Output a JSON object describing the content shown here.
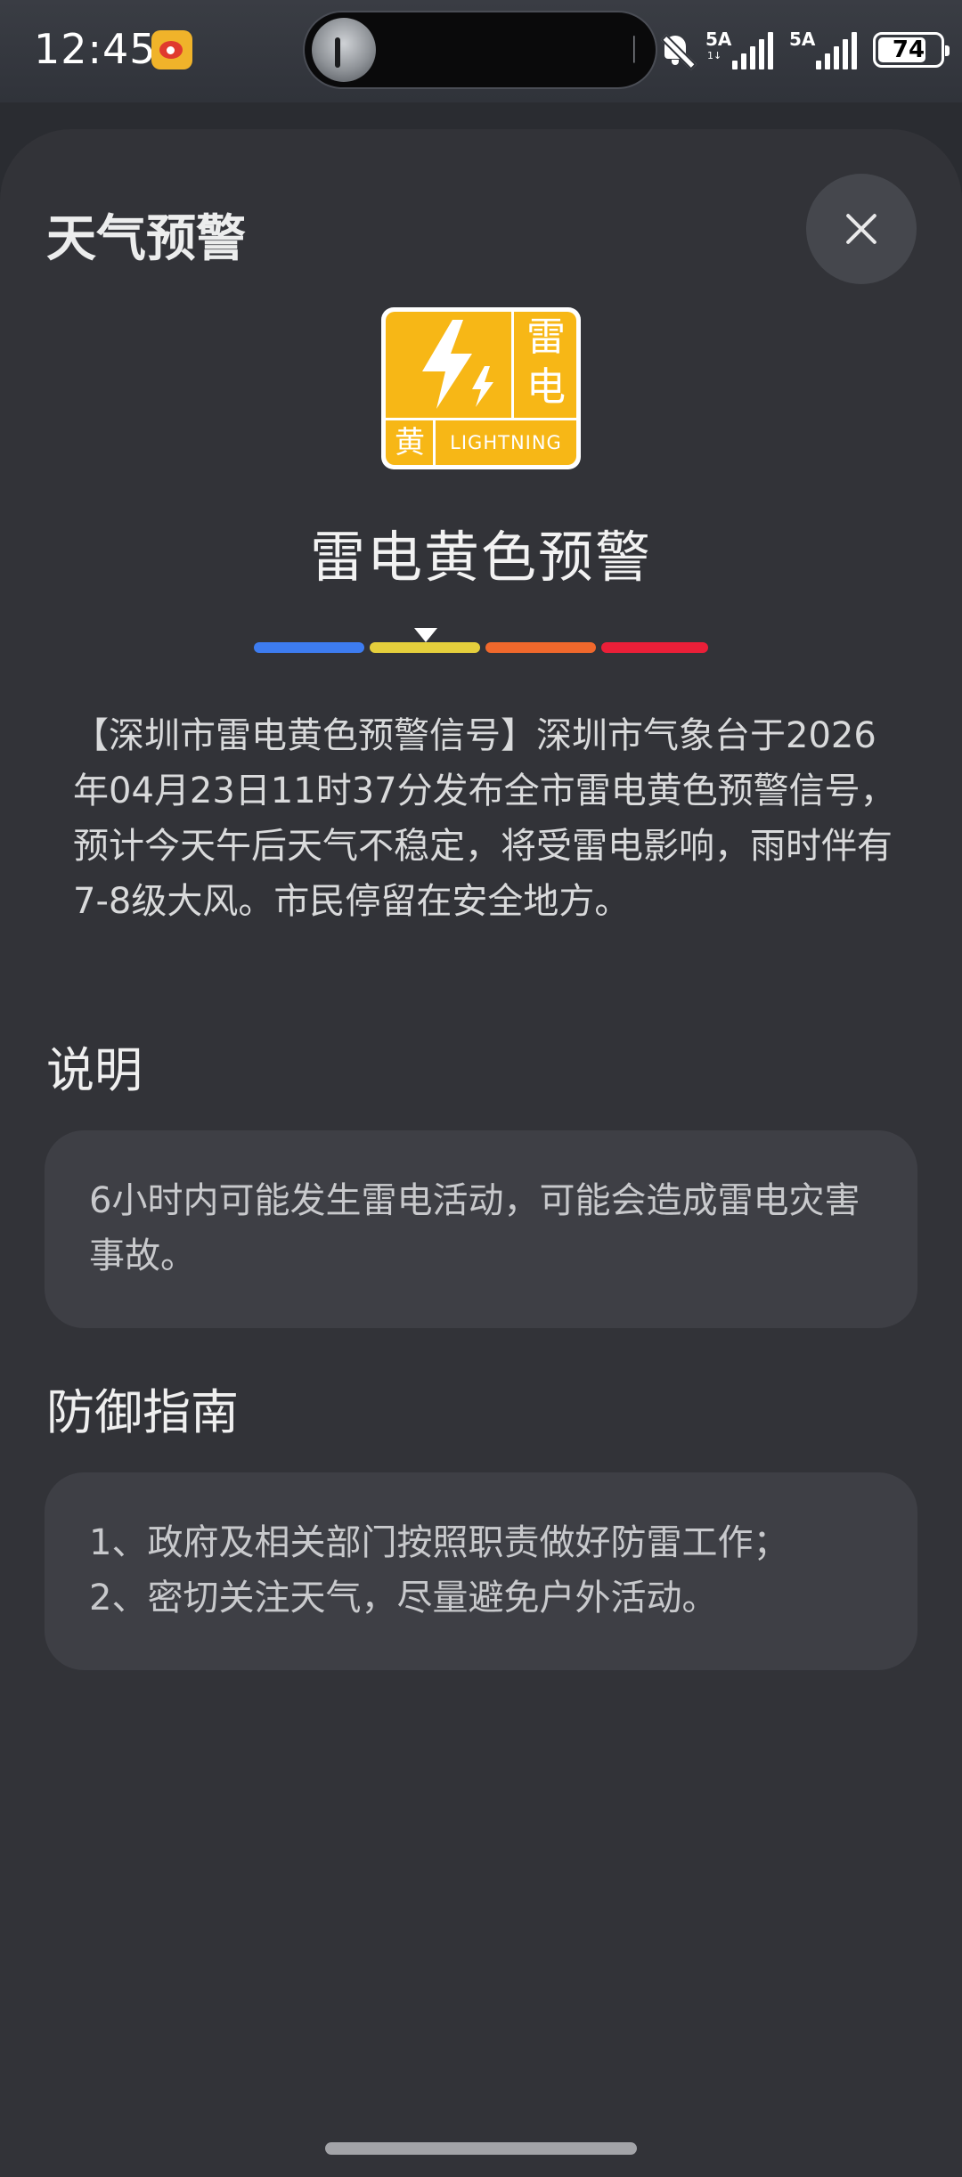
{
  "status_bar": {
    "time": "12:45",
    "battery": "74",
    "signal_1": "5A",
    "signal_2": "5A",
    "icons": [
      "weibo-icon",
      "media-island",
      "bell-off-icon",
      "signal-icon",
      "signal-icon",
      "battery-icon"
    ]
  },
  "sheet": {
    "title": "天气预警",
    "close_icon": "close-icon"
  },
  "alert": {
    "icon_text": {
      "top": "雷",
      "middle": "电",
      "color_char": "黄",
      "english": "LIGHTNING"
    },
    "title": "雷电黄色预警",
    "level_current": "yellow",
    "levels": [
      "blue",
      "yellow",
      "orange",
      "red"
    ],
    "colors": {
      "blue": "#3d7cf0",
      "yellow": "#e5cf3c",
      "orange": "#f0682c",
      "red": "#ea1f38",
      "icon_bg": "#f7b716"
    },
    "body": "【深圳市雷电黄色预警信号】深圳市气象台于2026年04月23日11时37分发布全市雷电黄色预警信号，预计今天午后天气不稳定，将受雷电影响，雨时伴有7-8级大风。市民停留在安全地方。"
  },
  "description": {
    "heading": "说明",
    "text": "6小时内可能发生雷电活动，可能会造成雷电灾害事故。"
  },
  "defense": {
    "heading": "防御指南",
    "lines": [
      "1、政府及相关部门按照职责做好防雷工作；",
      "2、密切关注天气，尽量避免户外活动。"
    ]
  }
}
